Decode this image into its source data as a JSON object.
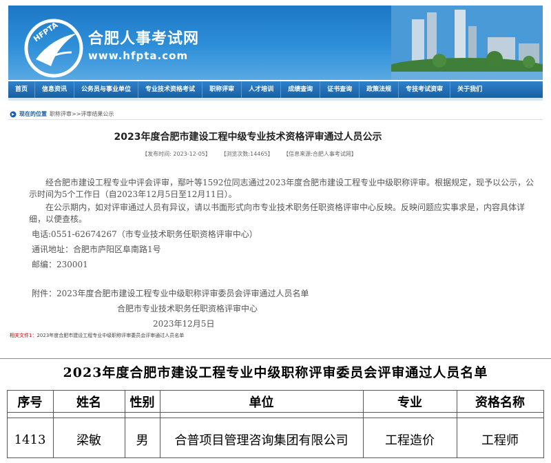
{
  "header": {
    "logo_text": "HFPTA",
    "site_title": "合肥人事考试网",
    "site_url": "www.hfpta.com"
  },
  "nav": [
    "首页",
    "信息资讯",
    "公务员与事业单位",
    "专业技术资格考试",
    "职称评审",
    "人才培训",
    "成绩查询",
    "证书查询",
    "政策法规",
    "专技考试资审",
    "关于我们"
  ],
  "breadcrumb": {
    "label": "现在的位置",
    "path": "职称评审>>评审结果公示"
  },
  "article": {
    "title": "2023年度合肥市建设工程中级专业技术资格评审通过人员公示",
    "meta_date": "【发布时间: 2023-12-05】",
    "meta_views": "【浏览次数:14465】",
    "meta_source": "【信息来源:合肥人事考试网】",
    "para1": "经合肥市建设工程专业中评会评审，鄢叶等1592位同志通过2023年度合肥市建设工程专业中级职称评审。根据规定，现予以公示，公示时间为5个工作日（自2023年12月5日至12月11日）。",
    "para2": "在公示期内，如对评审通过人员有异议，请以书面形式向市专业技术职务任职资格评审中心反映。反映问题应实事求是，内容具体详细，以便查核。",
    "phone": "电话:0551-62674267（市专业技术职务任职资格评审中心）",
    "address": "通讯地址：合肥市庐阳区阜南路1号",
    "postcode": "邮编：230001",
    "attachment": "附件：2023年度合肥市建设工程专业中级职称评审委员会评审通过人员名单",
    "sign_org": "合肥市专业技术职务任职资格评审中心",
    "sign_date": "2023年12月5日",
    "related_label": "相关文件1：",
    "related_text": "2023年度合肥市建设工程专业中级职称评审委员会评审通过人员名单"
  },
  "table": {
    "title": "2023年度合肥市建设工程专业中级职称评审委员会评审通过人员名单",
    "headers": [
      "序号",
      "姓名",
      "性别",
      "单位",
      "专业",
      "资格名称"
    ],
    "rows": [
      [
        "1413",
        "梁敏",
        "男",
        "合普项目管理咨询集团有限公司",
        "工程造价",
        "工程师"
      ]
    ]
  }
}
